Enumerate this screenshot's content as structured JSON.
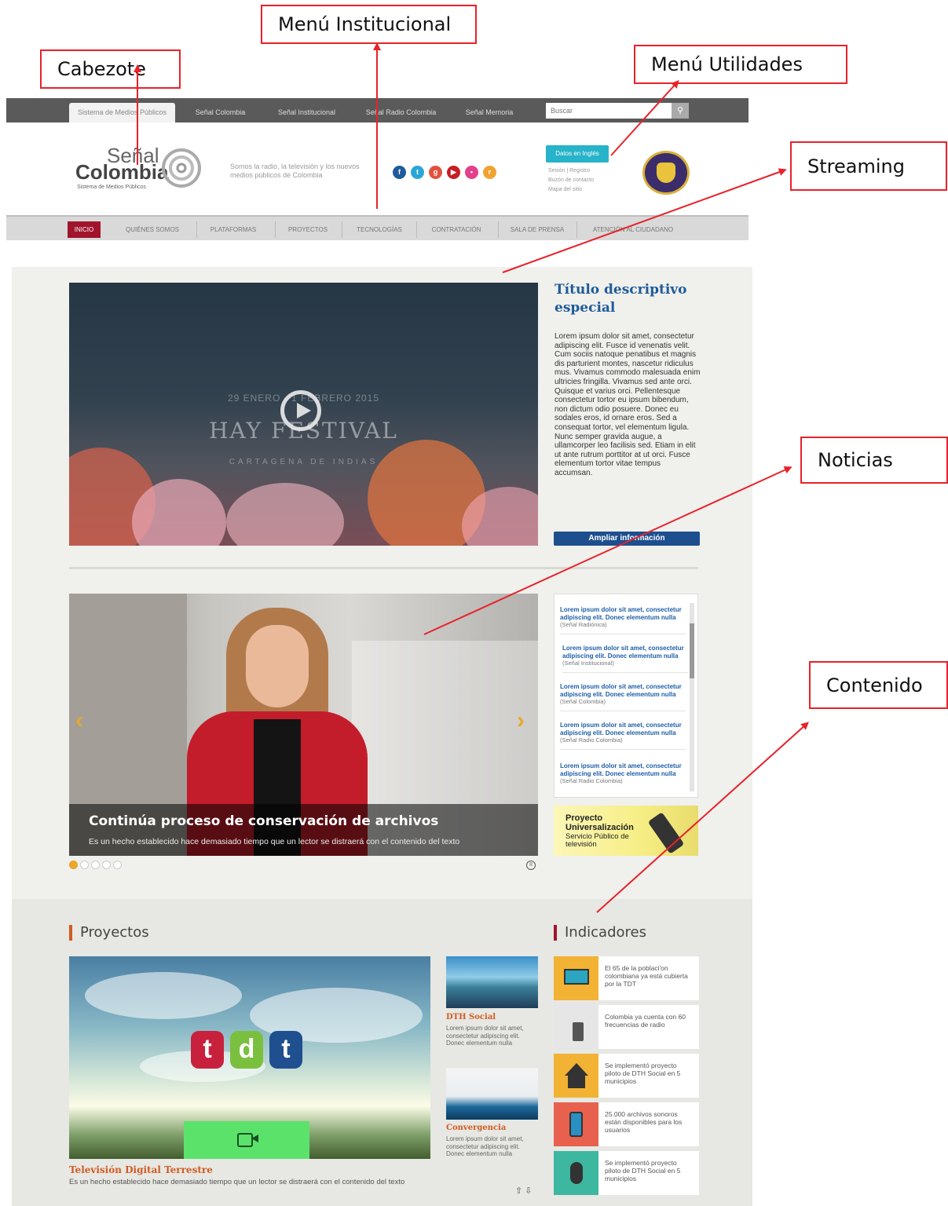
{
  "annotations": {
    "cabezote": "Cabezote",
    "menu_institucional": "Menú Institucional",
    "menu_utilidades": "Menú Utilidades",
    "streaming": "Streaming",
    "noticias": "Noticias",
    "contenido": "Contenido"
  },
  "topbar": {
    "tabs": [
      "Sistema de Medios Públicos",
      "Señal Colombia",
      "Señal Institucional",
      "Señal Radio Colombia",
      "Señal Memoria"
    ],
    "search_placeholder": "Buscar"
  },
  "header": {
    "logo_line1": "Señal",
    "logo_line2": "Colombia",
    "logo_sub": "Sistema de Medios Públicos",
    "tagline": "Somos la radio, la televisión y los nuevos medios públicos de Colombia",
    "social_icons": [
      "facebook-icon",
      "twitter-icon",
      "googleplus-icon",
      "youtube-icon",
      "flickr-icon",
      "rss-icon"
    ],
    "utility_button": "Datos en Inglés",
    "utility_links": [
      "Sesión | Registro",
      "Buzón de contacto",
      "Mapa del sitio"
    ]
  },
  "mainnav": {
    "items": [
      "INICIO",
      "QUIÉNES SOMOS",
      "PLATAFORMAS",
      "PROYECTOS",
      "TECNOLOGÍAS",
      "CONTRATACIÓN",
      "SALA DE PRENSA",
      "ATENCIÓN AL CIUDADANO"
    ]
  },
  "streaming": {
    "video_date": "29 ENERO - 1 FEBRERO 2015",
    "video_title": "HAY FESTIVAL",
    "video_city": "CARTAGENA DE INDIAS",
    "side_title": "Título descriptivo especial",
    "side_body": "Lorem ipsum dolor sit amet, consectetur adipiscing elit. Fusce id venenatis velit. Cum sociis natoque penatibus et magnis dis parturient montes, nascetur ridiculus mus. Vivamus commodo malesuada enim ultricies fringilla. Vivamus sed ante orci. Quisque et varius orci. Pellentesque consectetur tortor eu ipsum bibendum, non dictum odio posuere. Donec eu sodales eros, id ornare eros. Sed a consequat tortor, vel elementum ligula. Nunc semper gravida augue, a ullamcorper leo facilisis sed. Etiam in elit ut ante rutrum porttitor at ut orci. Fusce elementum tortor vitae tempus accumsan.",
    "more_button": "Ampliar información"
  },
  "news": {
    "slide_title": "Continúa proceso de conservación de archivos",
    "slide_text": "Es un hecho establecido hace demasiado tiempo que un lector se distraerá con el contenido del texto",
    "slider_dots_active": 1,
    "slider_dots_total": 5,
    "items": [
      {
        "title": "Lorem ipsum dolor sit amet, consectetur adipiscing elit. Donec elementum nulla",
        "source": "(Señal Radiónica)"
      },
      {
        "title": "Lorem ipsum dolor sit amet, consectetur adipiscing elit. Donec elementum nulla",
        "source": "(Señal Institucional)"
      },
      {
        "title": "Lorem ipsum dolor sit amet, consectetur adipiscing elit. Donec elementum nulla",
        "source": "(Señal Colombia)"
      },
      {
        "title": "Lorem ipsum dolor sit amet, consectetur adipiscing elit. Donec elementum nulla",
        "source": "(Señal Radio Colombia)"
      },
      {
        "title": "Lorem ipsum dolor sit amet, consectetur adipiscing elit. Donec elementum nulla",
        "source": "(Señal Radio Colombia)"
      }
    ],
    "banner_title": "Proyecto Universalización",
    "banner_text": "Servicio Público de televisión"
  },
  "projects": {
    "section_title": "Proyectos",
    "main_title": "Televisión Digital Terrestre",
    "main_text": "Es un hecho establecido hace demasiado tiempo que un lector se distraerá con el contenido del texto",
    "tdt_letters": [
      "t",
      "d",
      "t"
    ],
    "side": [
      {
        "title": "DTH Social",
        "text": "Lorem ipsum dolor sit amet, consectetur adipiscing elit. Donec elementum nulla"
      },
      {
        "title": "Convergencia",
        "text": "Lorem ipsum dolor sit amet, consectetur adipiscing elit. Donec elementum nulla"
      }
    ]
  },
  "indicators": {
    "section_title": "Indicadores",
    "items": [
      {
        "icon": "tv-icon",
        "color": "#f2b233",
        "text": "El 65 de la poblaci'on colombiana ya está cubierta por la TDT"
      },
      {
        "icon": "radio-icon",
        "color": "#e6e6e6",
        "text": "Colombia ya cuenta con 60 frecuencias de radio"
      },
      {
        "icon": "house-icon",
        "color": "#f2b233",
        "text": "Se implementó proyecto piloto de DTH Social en 5 municipios"
      },
      {
        "icon": "phone-icon",
        "color": "#e8614f",
        "text": "25.000 archivos sonoros están disponibles para los usuarios"
      },
      {
        "icon": "mouse-icon",
        "color": "#3db7a0",
        "text": "Se implementó proyecto piloto de DTH Social en 5 municipios"
      }
    ]
  },
  "colors": {
    "annotation": "#e8222a",
    "nav_active": "#a0152c",
    "title_blue": "#1e5b9a",
    "accent_orange": "#d35b1f",
    "button_blue": "#1d4f8f",
    "utility_cyan": "#27b3c9"
  }
}
